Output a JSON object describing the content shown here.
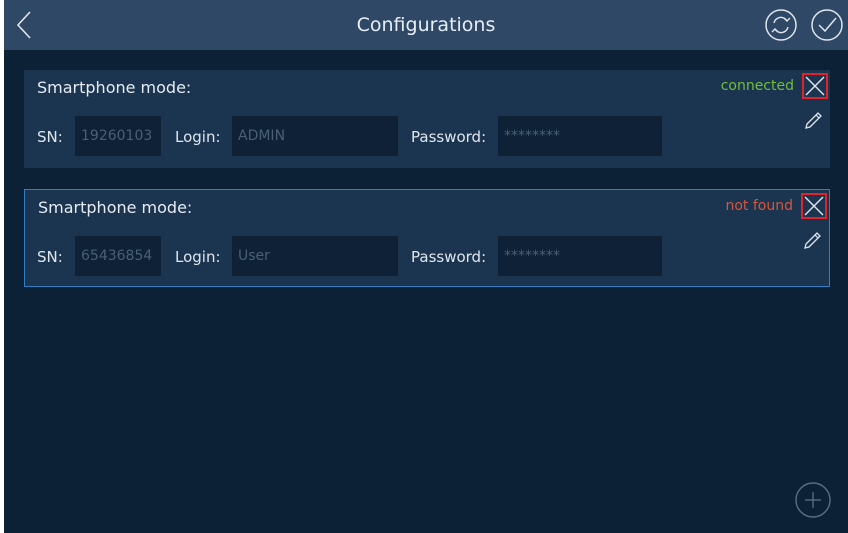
{
  "header": {
    "title": "Configurations",
    "back_icon": "chevron-left-icon",
    "refresh_icon": "refresh-circle-icon",
    "confirm_icon": "check-circle-icon"
  },
  "labels": {
    "sn": "SN:",
    "login": "Login:",
    "password": "Password:"
  },
  "cards": [
    {
      "title": "Smartphone mode:",
      "status": "connected",
      "status_color": "#6fbf3a",
      "sn": "19260103",
      "login": "ADMIN",
      "password": "********"
    },
    {
      "title": "Smartphone mode:",
      "status": "not found",
      "status_color": "#d8553a",
      "sn": "65436854",
      "login": "User",
      "password": "********"
    }
  ],
  "add_icon": "plus-circle-icon",
  "colors": {
    "header_bg": "#2e4866",
    "background": "#0d2136",
    "card_bg": "#1b3550",
    "selected_border": "#2f7fc4",
    "close_highlight": "#e0242a"
  }
}
